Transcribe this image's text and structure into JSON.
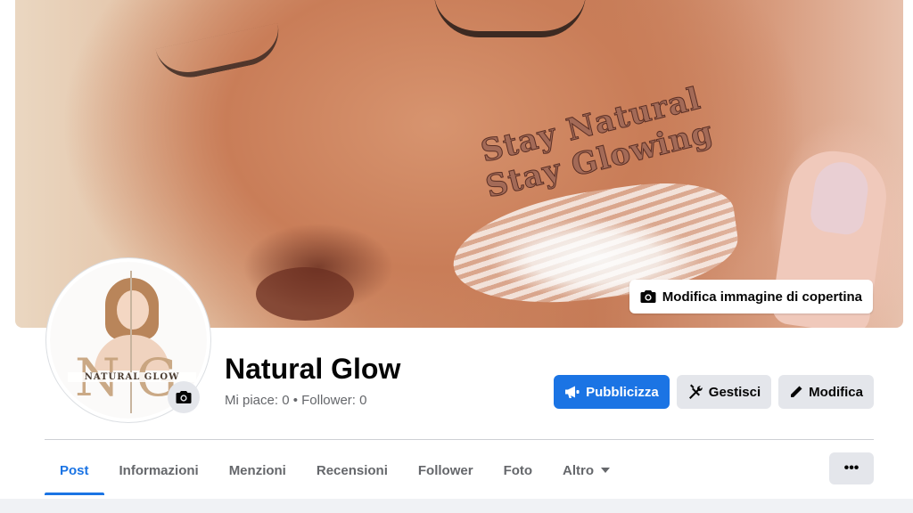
{
  "cover": {
    "tagline_line1": "Stay Natural",
    "tagline_line2": "Stay Glowing",
    "edit_button_label": "Modifica immagine di copertina"
  },
  "avatar": {
    "monogram": "NG",
    "brand_text": "NATURAL GLOW"
  },
  "page": {
    "name": "Natural Glow",
    "stats": "Mi piace: 0 • Follower: 0"
  },
  "actions": {
    "promote": "Pubblicizza",
    "manage": "Gestisci",
    "edit": "Modifica"
  },
  "tabs": [
    {
      "label": "Post",
      "active": true
    },
    {
      "label": "Informazioni"
    },
    {
      "label": "Menzioni"
    },
    {
      "label": "Recensioni"
    },
    {
      "label": "Follower"
    },
    {
      "label": "Foto"
    },
    {
      "label": "Altro"
    }
  ],
  "more_button": "•••",
  "colors": {
    "accent": "#1b74e4",
    "secondary_button": "#e4e6eb",
    "muted_text": "#65676b"
  },
  "icons": {
    "camera": "camera-icon",
    "megaphone": "megaphone-icon",
    "tools": "tools-icon",
    "pencil": "pencil-icon",
    "dropdown": "caret-down-icon"
  }
}
